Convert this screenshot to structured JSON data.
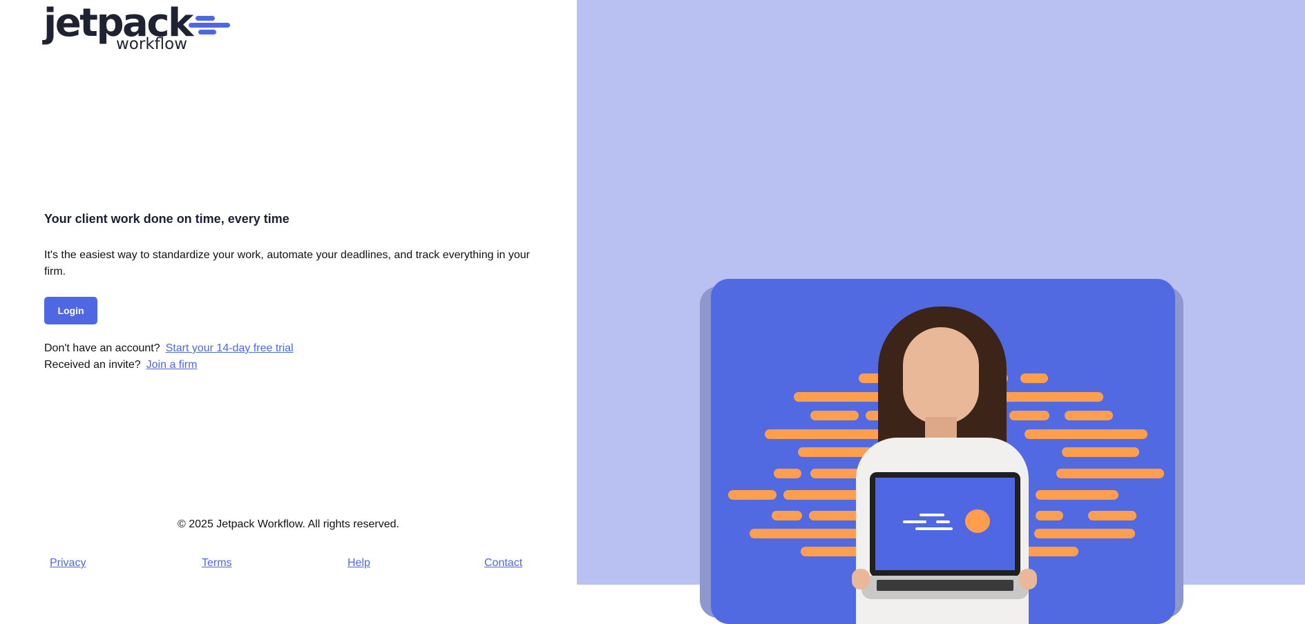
{
  "brand": {
    "logo_word": "jetpack",
    "logo_sub": "workflow"
  },
  "hero": {
    "headline": "Your client work done on time, every time",
    "subtext": "It's the easiest way to standardize your work, automate your deadlines, and track everything in your firm."
  },
  "actions": {
    "login_label": "Login",
    "no_account_text": "Don't have an account?",
    "trial_link": "Start your 14-day free trial",
    "invite_text": "Received an invite?",
    "join_link": "Join a firm"
  },
  "footer": {
    "copyright": "© 2025 Jetpack Workflow. All rights reserved.",
    "links": [
      "Privacy",
      "Terms",
      "Help",
      "Contact"
    ]
  },
  "colors": {
    "accent": "#4f67e3",
    "panel_bg": "#b8c1f2",
    "card_bg": "#5169e1",
    "orange": "#ff9e4d"
  }
}
